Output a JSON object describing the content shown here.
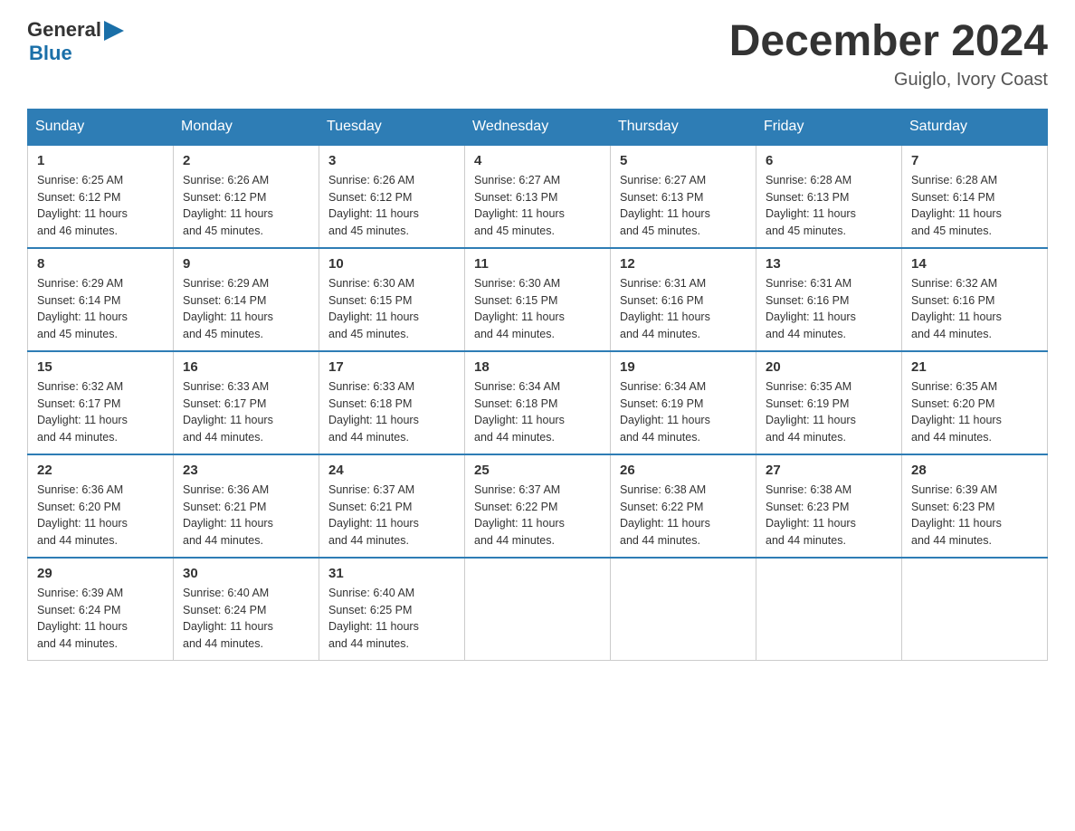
{
  "header": {
    "logo_general": "General",
    "logo_blue": "Blue",
    "month_title": "December 2024",
    "location": "Guiglo, Ivory Coast"
  },
  "days_of_week": [
    "Sunday",
    "Monday",
    "Tuesday",
    "Wednesday",
    "Thursday",
    "Friday",
    "Saturday"
  ],
  "weeks": [
    [
      {
        "day": "1",
        "sunrise": "6:25 AM",
        "sunset": "6:12 PM",
        "daylight": "11 hours and 46 minutes."
      },
      {
        "day": "2",
        "sunrise": "6:26 AM",
        "sunset": "6:12 PM",
        "daylight": "11 hours and 45 minutes."
      },
      {
        "day": "3",
        "sunrise": "6:26 AM",
        "sunset": "6:12 PM",
        "daylight": "11 hours and 45 minutes."
      },
      {
        "day": "4",
        "sunrise": "6:27 AM",
        "sunset": "6:13 PM",
        "daylight": "11 hours and 45 minutes."
      },
      {
        "day": "5",
        "sunrise": "6:27 AM",
        "sunset": "6:13 PM",
        "daylight": "11 hours and 45 minutes."
      },
      {
        "day": "6",
        "sunrise": "6:28 AM",
        "sunset": "6:13 PM",
        "daylight": "11 hours and 45 minutes."
      },
      {
        "day": "7",
        "sunrise": "6:28 AM",
        "sunset": "6:14 PM",
        "daylight": "11 hours and 45 minutes."
      }
    ],
    [
      {
        "day": "8",
        "sunrise": "6:29 AM",
        "sunset": "6:14 PM",
        "daylight": "11 hours and 45 minutes."
      },
      {
        "day": "9",
        "sunrise": "6:29 AM",
        "sunset": "6:14 PM",
        "daylight": "11 hours and 45 minutes."
      },
      {
        "day": "10",
        "sunrise": "6:30 AM",
        "sunset": "6:15 PM",
        "daylight": "11 hours and 45 minutes."
      },
      {
        "day": "11",
        "sunrise": "6:30 AM",
        "sunset": "6:15 PM",
        "daylight": "11 hours and 44 minutes."
      },
      {
        "day": "12",
        "sunrise": "6:31 AM",
        "sunset": "6:16 PM",
        "daylight": "11 hours and 44 minutes."
      },
      {
        "day": "13",
        "sunrise": "6:31 AM",
        "sunset": "6:16 PM",
        "daylight": "11 hours and 44 minutes."
      },
      {
        "day": "14",
        "sunrise": "6:32 AM",
        "sunset": "6:16 PM",
        "daylight": "11 hours and 44 minutes."
      }
    ],
    [
      {
        "day": "15",
        "sunrise": "6:32 AM",
        "sunset": "6:17 PM",
        "daylight": "11 hours and 44 minutes."
      },
      {
        "day": "16",
        "sunrise": "6:33 AM",
        "sunset": "6:17 PM",
        "daylight": "11 hours and 44 minutes."
      },
      {
        "day": "17",
        "sunrise": "6:33 AM",
        "sunset": "6:18 PM",
        "daylight": "11 hours and 44 minutes."
      },
      {
        "day": "18",
        "sunrise": "6:34 AM",
        "sunset": "6:18 PM",
        "daylight": "11 hours and 44 minutes."
      },
      {
        "day": "19",
        "sunrise": "6:34 AM",
        "sunset": "6:19 PM",
        "daylight": "11 hours and 44 minutes."
      },
      {
        "day": "20",
        "sunrise": "6:35 AM",
        "sunset": "6:19 PM",
        "daylight": "11 hours and 44 minutes."
      },
      {
        "day": "21",
        "sunrise": "6:35 AM",
        "sunset": "6:20 PM",
        "daylight": "11 hours and 44 minutes."
      }
    ],
    [
      {
        "day": "22",
        "sunrise": "6:36 AM",
        "sunset": "6:20 PM",
        "daylight": "11 hours and 44 minutes."
      },
      {
        "day": "23",
        "sunrise": "6:36 AM",
        "sunset": "6:21 PM",
        "daylight": "11 hours and 44 minutes."
      },
      {
        "day": "24",
        "sunrise": "6:37 AM",
        "sunset": "6:21 PM",
        "daylight": "11 hours and 44 minutes."
      },
      {
        "day": "25",
        "sunrise": "6:37 AM",
        "sunset": "6:22 PM",
        "daylight": "11 hours and 44 minutes."
      },
      {
        "day": "26",
        "sunrise": "6:38 AM",
        "sunset": "6:22 PM",
        "daylight": "11 hours and 44 minutes."
      },
      {
        "day": "27",
        "sunrise": "6:38 AM",
        "sunset": "6:23 PM",
        "daylight": "11 hours and 44 minutes."
      },
      {
        "day": "28",
        "sunrise": "6:39 AM",
        "sunset": "6:23 PM",
        "daylight": "11 hours and 44 minutes."
      }
    ],
    [
      {
        "day": "29",
        "sunrise": "6:39 AM",
        "sunset": "6:24 PM",
        "daylight": "11 hours and 44 minutes."
      },
      {
        "day": "30",
        "sunrise": "6:40 AM",
        "sunset": "6:24 PM",
        "daylight": "11 hours and 44 minutes."
      },
      {
        "day": "31",
        "sunrise": "6:40 AM",
        "sunset": "6:25 PM",
        "daylight": "11 hours and 44 minutes."
      },
      null,
      null,
      null,
      null
    ]
  ],
  "labels": {
    "sunrise": "Sunrise:",
    "sunset": "Sunset:",
    "daylight": "Daylight:"
  }
}
